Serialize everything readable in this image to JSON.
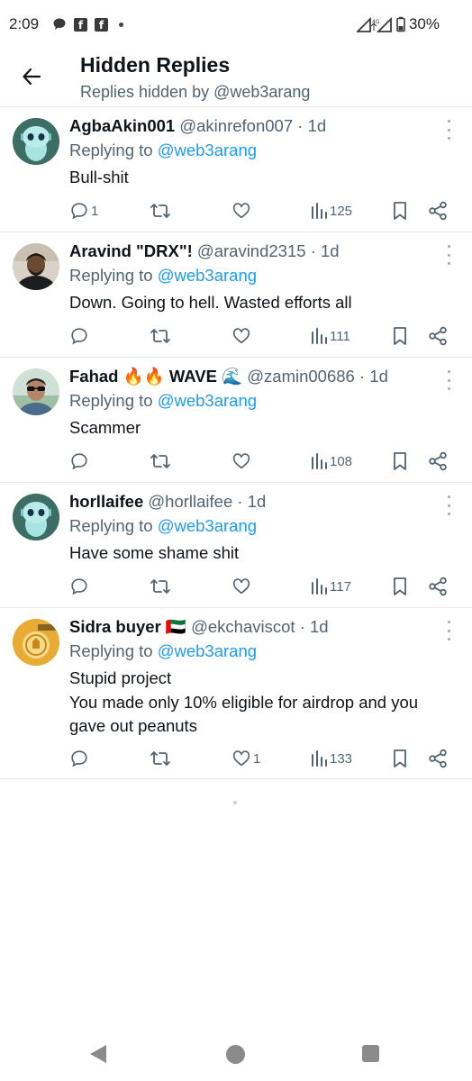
{
  "status_bar": {
    "time": "2:09",
    "battery": "30%",
    "network": "4G",
    "icons": [
      "chat-bubble-icon",
      "facebook-icon",
      "facebook-icon",
      "notification-dot-icon",
      "signal-icon",
      "battery-icon"
    ]
  },
  "header": {
    "title": "Hidden Replies",
    "subtitle": "Replies hidden by @web3arang"
  },
  "replies": [
    {
      "name": "AgbaAkin001",
      "handle": "@akinrefon007",
      "time": "1d",
      "replying_prefix": "Replying to ",
      "replying_to": "@web3arang",
      "text": "Bull-shit",
      "reply_count": "1",
      "retweet_count": "",
      "like_count": "",
      "views": "125",
      "avatar": "robot-avatar",
      "flags": ""
    },
    {
      "name": "Aravind \"DRX\"!",
      "handle": "@aravind2315",
      "time": "1d",
      "replying_prefix": "Replying to ",
      "replying_to": "@web3arang",
      "text": "Down. Going to hell. Wasted efforts all",
      "reply_count": "",
      "retweet_count": "",
      "like_count": "",
      "views": "111",
      "avatar": "photo-avatar",
      "flags": ""
    },
    {
      "name": "Fahad 🔥🔥 WAVE 🌊",
      "handle": "@zamin00686",
      "time": "1d",
      "replying_prefix": "Replying to ",
      "replying_to": "@web3arang",
      "text": "Scammer",
      "reply_count": "",
      "retweet_count": "",
      "like_count": "",
      "views": "108",
      "avatar": "sunglasses-avatar",
      "flags": ""
    },
    {
      "name": "horllaifee",
      "handle": "@horllaifee",
      "time": "1d",
      "replying_prefix": "Replying to ",
      "replying_to": "@web3arang",
      "text": "Have some shame shit",
      "reply_count": "",
      "retweet_count": "",
      "like_count": "",
      "views": "117",
      "avatar": "robot-avatar",
      "flags": ""
    },
    {
      "name": "Sidra buyer 🇦🇪",
      "handle": "@ekchaviscot",
      "time": "1d",
      "replying_prefix": "Replying to ",
      "replying_to": "@web3arang",
      "text": "Stupid project\nYou made only 10% eligible for airdrop and you gave out peanuts",
      "reply_count": "",
      "retweet_count": "",
      "like_count": "1",
      "views": "133",
      "avatar": "gold-logo-avatar",
      "flags": ""
    }
  ],
  "colors": {
    "link": "#1d9bf0",
    "secondary_text": "#536471",
    "primary_text": "#0f1419",
    "divider": "#e6e9eb"
  },
  "nav": {
    "icons": [
      "back-triangle-icon",
      "home-circle-icon",
      "recents-square-icon"
    ]
  }
}
